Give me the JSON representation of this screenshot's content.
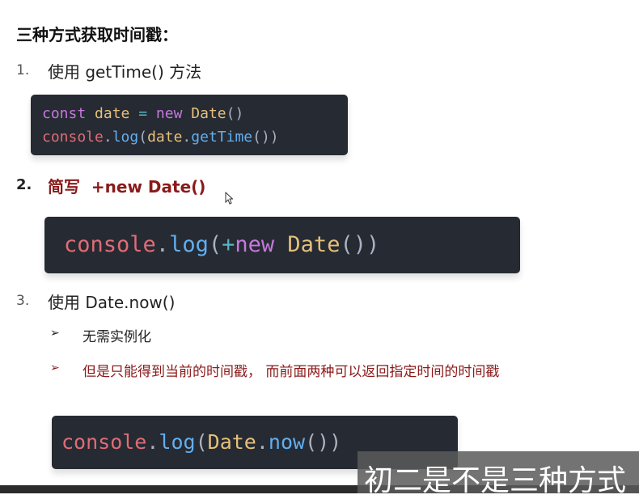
{
  "title": "三种方式获取时间戳：",
  "items": [
    {
      "number": "1.",
      "text": "使用 getTime() 方法"
    },
    {
      "number": "2.",
      "text": "简写  +new Date()"
    },
    {
      "number": "3.",
      "text": "使用 Date.now()"
    }
  ],
  "code1": {
    "line1": {
      "kw": "const",
      "var": "date",
      "op": "=",
      "kw2": "new",
      "cls": "Date",
      "punc": "()"
    },
    "line2": {
      "obj": "console",
      "dot": ".",
      "fn": "log",
      "p1": "(",
      "var": "date",
      "dot2": ".",
      "fn2": "getTime",
      "p2": "())"
    }
  },
  "code2": {
    "obj": "console",
    "dot": ".",
    "fn": "log",
    "p1": "(",
    "op": "+",
    "kw": "new",
    "cls": "Date",
    "p2": "())"
  },
  "code3": {
    "obj": "console",
    "dot": ".",
    "fn": "log",
    "p1": "(",
    "cls": "Date",
    "dot2": ".",
    "fn2": "now",
    "p2": "())"
  },
  "bullets": [
    {
      "icon": "➢",
      "text": "无需实例化"
    },
    {
      "icon": "➢",
      "text": "但是只能得到当前的时间戳， 而前面两种可以返回指定时间的时间戳"
    }
  ],
  "subtitle": "初二是不是三种方式",
  "colors": {
    "code_bg": "#262a33",
    "accent_red": "#8b1a1a"
  }
}
